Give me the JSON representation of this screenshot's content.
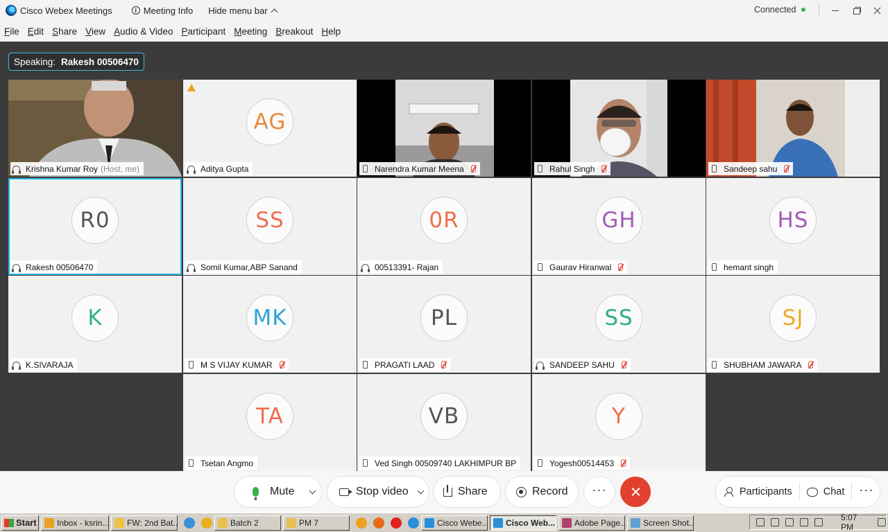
{
  "titlebar": {
    "app_title": "Cisco Webex Meetings",
    "meeting_info": "Meeting Info",
    "hide_menu": "Hide menu bar",
    "status": "Connected"
  },
  "menubar": [
    "File",
    "Edit",
    "Share",
    "View",
    "Audio & Video",
    "Participant",
    "Meeting",
    "Breakout",
    "Help"
  ],
  "speaking": {
    "label": "Speaking:",
    "name": "Rakesh 00506470"
  },
  "participants": [
    {
      "name": "Krishna Kumar Roy",
      "suffix": "(Host, me)",
      "initials": "",
      "video": true,
      "device": "audio",
      "muted": false,
      "color": ""
    },
    {
      "name": "Aditya Gupta",
      "suffix": "",
      "initials": "AG",
      "video": false,
      "device": "audio",
      "muted": false,
      "color": "#e8893b",
      "warning": true
    },
    {
      "name": "Narendra Kumar Meena",
      "suffix": "",
      "initials": "",
      "video": true,
      "device": "phone",
      "muted": true,
      "color": ""
    },
    {
      "name": "Rahul Singh",
      "suffix": "",
      "initials": "",
      "video": true,
      "device": "phone",
      "muted": true,
      "color": ""
    },
    {
      "name": "Sandeep sahu",
      "suffix": "",
      "initials": "",
      "video": true,
      "device": "phone",
      "muted": true,
      "color": ""
    },
    {
      "name": "Rakesh 00506470",
      "suffix": "",
      "initials": "R0",
      "video": false,
      "device": "audio",
      "muted": false,
      "color": "#555555",
      "active": true
    },
    {
      "name": "Somil Kumar,ABP Sanand",
      "suffix": "",
      "initials": "SS",
      "video": false,
      "device": "audio",
      "muted": false,
      "color": "#f06e4e"
    },
    {
      "name": "00513391- Rajan",
      "suffix": "",
      "initials": "0R",
      "video": false,
      "device": "audio",
      "muted": false,
      "color": "#f06e4e"
    },
    {
      "name": "Gaurav Hiranwal",
      "suffix": "",
      "initials": "GH",
      "video": false,
      "device": "phone",
      "muted": true,
      "color": "#a05cb6"
    },
    {
      "name": "hemant singh",
      "suffix": "",
      "initials": "HS",
      "video": false,
      "device": "phone",
      "muted": false,
      "color": "#a05cb6"
    },
    {
      "name": "K.SIVARAJA",
      "suffix": "",
      "initials": "K",
      "video": false,
      "device": "audio",
      "muted": false,
      "color": "#2fae8c"
    },
    {
      "name": "M S VIJAY KUMAR",
      "suffix": "",
      "initials": "MK",
      "video": false,
      "device": "phone",
      "muted": true,
      "color": "#2ea3d8"
    },
    {
      "name": "PRAGATI LAAD",
      "suffix": "",
      "initials": "PL",
      "video": false,
      "device": "phone",
      "muted": true,
      "color": "#555555"
    },
    {
      "name": "SANDEEP SAHU",
      "suffix": "",
      "initials": "SS",
      "video": false,
      "device": "audio",
      "muted": true,
      "color": "#2fae8c"
    },
    {
      "name": "SHUBHAM JAWARA",
      "suffix": "",
      "initials": "SJ",
      "video": false,
      "device": "phone",
      "muted": true,
      "color": "#f0aa2a"
    },
    {
      "name": "Tsetan Angmo",
      "suffix": "",
      "initials": "TA",
      "video": false,
      "device": "phone",
      "muted": false,
      "color": "#f06e4e"
    },
    {
      "name": "Ved Singh 00509740 LAKHIMPUR BP",
      "suffix": "",
      "initials": "VB",
      "video": false,
      "device": "phone",
      "muted": false,
      "color": "#555555"
    },
    {
      "name": "Yogesh00514453",
      "suffix": "",
      "initials": "Y",
      "video": false,
      "device": "phone",
      "muted": true,
      "color": "#f06e4e"
    }
  ],
  "controls": {
    "mute": "Mute",
    "stop_video": "Stop video",
    "share": "Share",
    "record": "Record",
    "more": "···",
    "participants": "Participants",
    "chat": "Chat",
    "right_more": "···"
  },
  "taskbar": {
    "start": "Start",
    "items": [
      {
        "label": "Inbox - ksrin...",
        "color": "#e8a020",
        "pressed": false
      },
      {
        "label": "FW: 2nd Bat...",
        "color": "#f0c040",
        "pressed": false
      },
      {
        "label": "Batch 2",
        "color": "#e8c050",
        "pressed": false
      },
      {
        "label": "PM 7",
        "color": "#e8c050",
        "pressed": false
      },
      {
        "label": "Cisco Webe...",
        "color": "#2a8fd8",
        "pressed": false
      },
      {
        "label": "Cisco Web...",
        "color": "#2a8fd8",
        "pressed": true
      },
      {
        "label": "Adobe Page...",
        "color": "#b04070",
        "pressed": false
      },
      {
        "label": "Screen Shot...",
        "color": "#60a0d0",
        "pressed": false
      }
    ],
    "clock": "5:07 PM"
  }
}
